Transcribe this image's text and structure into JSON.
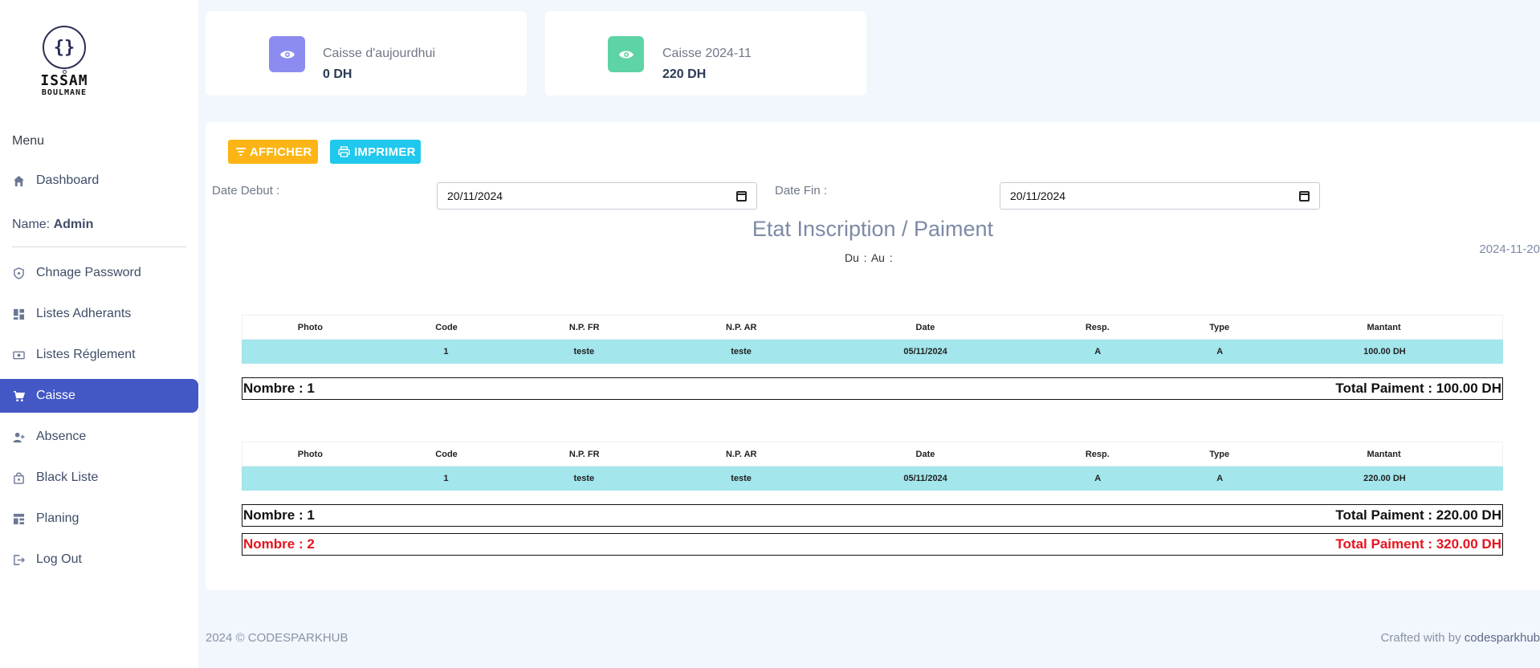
{
  "logo": {
    "line1": "ISSAM",
    "line2": "BOULMANE",
    "symbol": "{}"
  },
  "sidebar": {
    "menu_label": "Menu",
    "name_label": "Name:",
    "name_value": "Admin",
    "items": [
      {
        "label": "Dashboard",
        "icon": "home-icon"
      },
      {
        "label": "Chnage Password",
        "icon": "shield-icon"
      },
      {
        "label": "Listes Adherants",
        "icon": "grid-icon"
      },
      {
        "label": "Listes Réglement",
        "icon": "money-icon"
      },
      {
        "label": "Caisse",
        "icon": "cart-icon",
        "active": true
      },
      {
        "label": "Absence",
        "icon": "user-plus-icon"
      },
      {
        "label": "Black Liste",
        "icon": "lock-bag-icon"
      },
      {
        "label": "Planing",
        "icon": "layout-icon"
      },
      {
        "label": "Log Out",
        "icon": "logout-icon"
      }
    ]
  },
  "cards": [
    {
      "label": "Caisse d'aujourdhui",
      "value": "0 DH",
      "color": "#8c8cf0",
      "icon": "eye-icon"
    },
    {
      "label": "Caisse 2024-11",
      "value": "220 DH",
      "color": "#5ed3a6",
      "icon": "eye-icon"
    }
  ],
  "toolbar": {
    "afficher_label": "AFFICHER",
    "imprimer_label": "IMPRIMER"
  },
  "filters": {
    "date_debut_label": "Date Debut :",
    "date_debut_value": "20/11/2024",
    "date_fin_label": "Date Fin :",
    "date_fin_value": "20/11/2024"
  },
  "report": {
    "title": "Etat Inscription / Paiment",
    "date": "2024-11-20",
    "du_label": "Du :",
    "au_label": "Au :"
  },
  "table_headers": [
    "Photo",
    "Code",
    "N.P. FR",
    "N.P. AR",
    "Date",
    "Resp.",
    "Type",
    "Mantant"
  ],
  "tables": [
    {
      "rows": [
        [
          "",
          "1",
          "teste",
          "teste",
          "05/11/2024",
          "A",
          "A",
          "100.00 DH"
        ]
      ],
      "summary_count": "Nombre : 1",
      "summary_total": "Total Paiment : 100.00 DH"
    },
    {
      "rows": [
        [
          "",
          "1",
          "teste",
          "teste",
          "05/11/2024",
          "A",
          "A",
          "220.00 DH"
        ]
      ],
      "summary_count": "Nombre : 1",
      "summary_total": "Total Paiment : 220.00 DH"
    }
  ],
  "grand_total": {
    "count": "Nombre : 2",
    "total": "Total Paiment : 320.00 DH",
    "color": "#e5141f"
  },
  "footer": {
    "copyright": "2024 © CODESPARKHUB",
    "crafted_prefix": "Crafted with by",
    "crafted_brand": "codesparkhub"
  }
}
